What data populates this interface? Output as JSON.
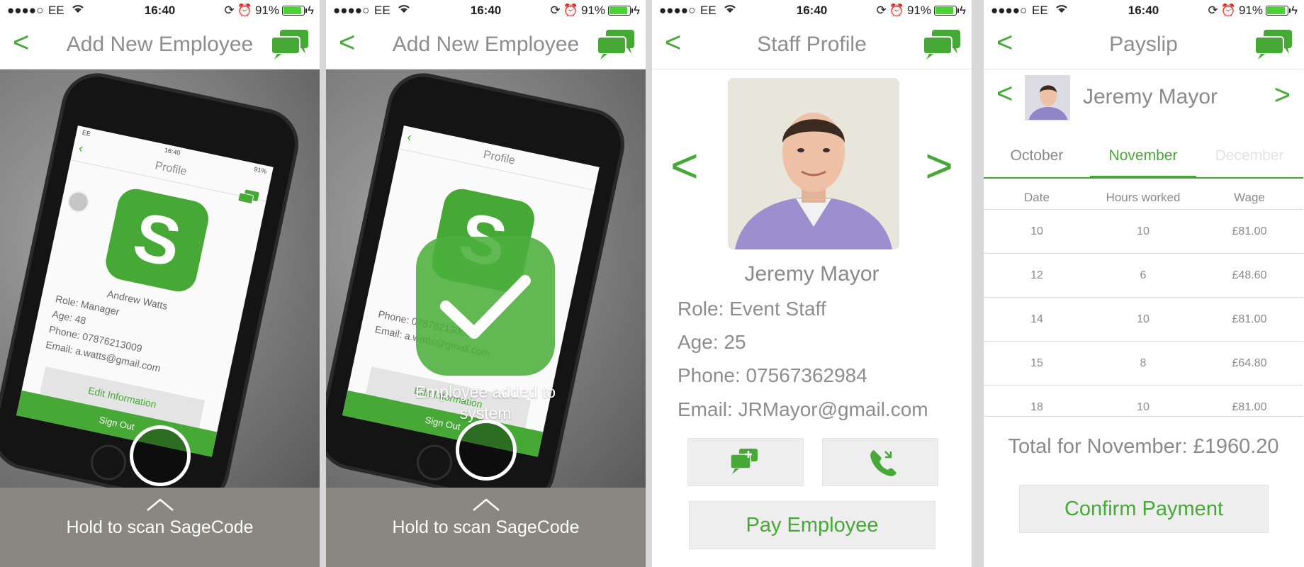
{
  "status_bar": {
    "signal": "●●●●○",
    "carrier": "EE",
    "time": "16:40",
    "battery": "91%"
  },
  "colors": {
    "accent": "#46a835",
    "text_gray": "#8a8a8a",
    "button_bg": "#eeeeee"
  },
  "screen1": {
    "nav_back": "<",
    "title": "Add New Employee",
    "hold_label": "Hold to scan SageCode",
    "phone_photo": {
      "title": "Profile",
      "status_time": "16:40",
      "status_battery": "91%",
      "carrier": "EE",
      "code_letter": "S",
      "name": "Andrew Watts",
      "role": "Role: Manager",
      "age": "Age: 48",
      "phone": "Phone: 07876213009",
      "email": "Email: a.watts@gmail.com",
      "edit_button": "Edit Information",
      "sign_out": "Sign Out"
    }
  },
  "screen2": {
    "nav_back": "<",
    "title": "Add New Employee",
    "success_message": "Employee added to system",
    "hold_label": "Hold to scan SageCode",
    "phone_photo": {
      "title": "Profile",
      "code_letter": "S",
      "email": "Email: a.watts@gmail.com",
      "phone": "Phone: 07876213009",
      "edit_button": "Edit Information",
      "sign_out": "Sign Out"
    }
  },
  "screen3": {
    "nav_back": "<",
    "title": "Staff Profile",
    "prev": "<",
    "next": ">",
    "name": "Jeremy Mayor",
    "role": "Role: Event Staff",
    "age": "Age: 25",
    "phone": "Phone: 07567362984",
    "email": "Email: JRMayor@gmail.com",
    "message_button_icon": "chat-add-icon",
    "call_button_icon": "phone-icon",
    "pay_button": "Pay Employee"
  },
  "screen4": {
    "nav_back": "<",
    "title": "Payslip",
    "employee_name": "Jeremy Mayor",
    "prev": "<",
    "next": ">",
    "months": [
      "October",
      "November",
      "December"
    ],
    "selected_month": "November",
    "table": {
      "headers": [
        "Date",
        "Hours worked",
        "Wage"
      ],
      "rows": [
        [
          "10",
          "10",
          "£81.00"
        ],
        [
          "12",
          "6",
          "£48.60"
        ],
        [
          "14",
          "10",
          "£81.00"
        ],
        [
          "15",
          "8",
          "£64.80"
        ],
        [
          "18",
          "10",
          "£81.00"
        ]
      ]
    },
    "total": "Total for November: £1960.20",
    "confirm_button": "Confirm Payment"
  }
}
